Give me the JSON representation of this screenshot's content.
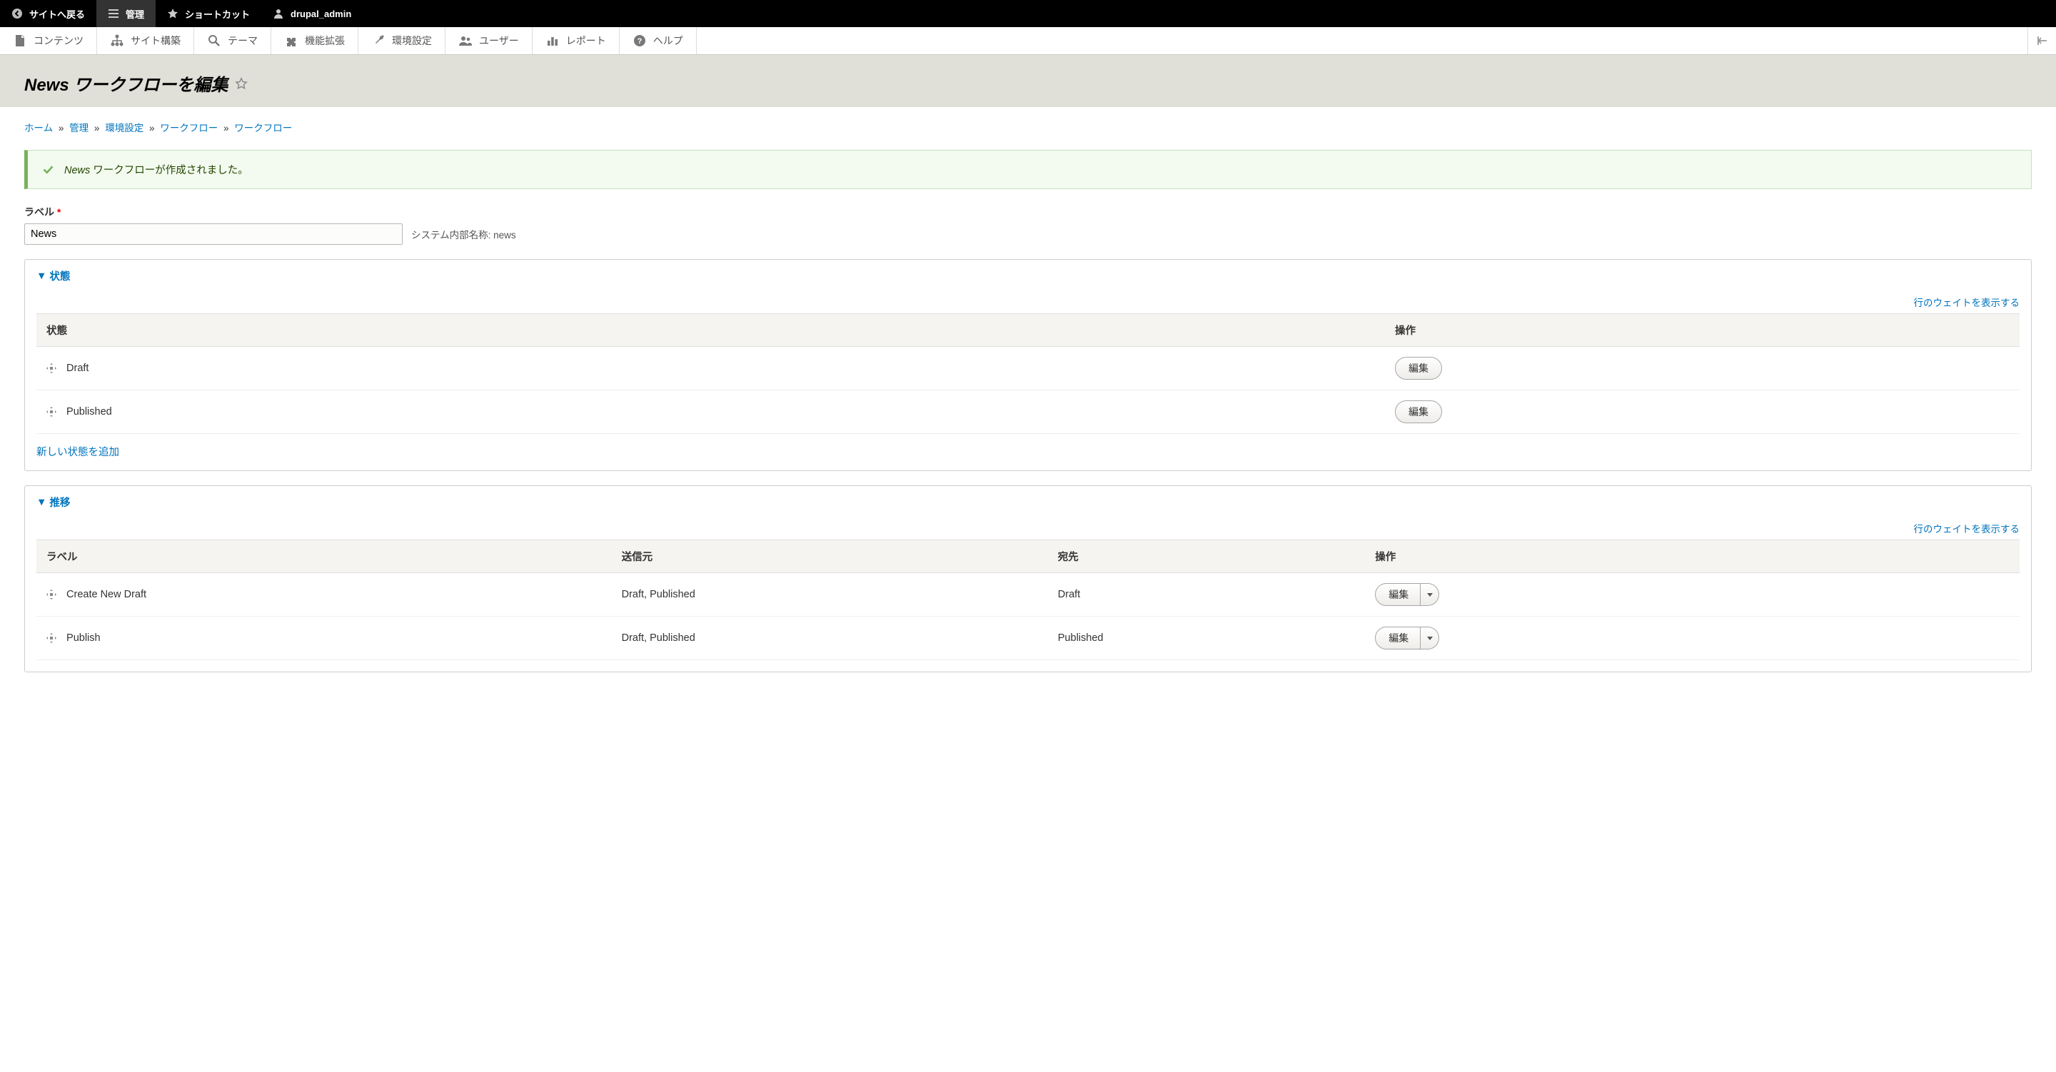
{
  "toolbar_black": {
    "back": "サイトへ戻る",
    "manage": "管理",
    "shortcuts": "ショートカット",
    "user": "drupal_admin"
  },
  "toolbar_white": {
    "items": [
      {
        "name": "content",
        "label": "コンテンツ"
      },
      {
        "name": "structure",
        "label": "サイト構築"
      },
      {
        "name": "appearance",
        "label": "テーマ"
      },
      {
        "name": "extend",
        "label": "機能拡張"
      },
      {
        "name": "config",
        "label": "環境設定"
      },
      {
        "name": "people",
        "label": "ユーザー"
      },
      {
        "name": "reports",
        "label": "レポート"
      },
      {
        "name": "help",
        "label": "ヘルプ"
      }
    ]
  },
  "page_title_prefix": "News",
  "page_title_suffix": " ワークフローを編集",
  "breadcrumb": {
    "items": [
      "ホーム",
      "管理",
      "環境設定",
      "ワークフロー",
      "ワークフロー"
    ]
  },
  "status_message": {
    "em": "News",
    "text": " ワークフローが作成されました。"
  },
  "form": {
    "label_label": "ラベル",
    "label_value": "News",
    "machine_name_prefix": "システム内部名称: ",
    "machine_name_value": "news"
  },
  "states_panel": {
    "title": "状態",
    "show_weights": "行のウェイトを表示する",
    "headers": {
      "state": "状態",
      "ops": "操作"
    },
    "rows": [
      {
        "label": "Draft",
        "op": "編集"
      },
      {
        "label": "Published",
        "op": "編集"
      }
    ],
    "add_link": "新しい状態を追加"
  },
  "transitions_panel": {
    "title": "推移",
    "show_weights": "行のウェイトを表示する",
    "headers": {
      "label": "ラベル",
      "from": "送信元",
      "to": "宛先",
      "ops": "操作"
    },
    "rows": [
      {
        "label": "Create New Draft",
        "from": "Draft, Published",
        "to": "Draft",
        "op": "編集"
      },
      {
        "label": "Publish",
        "from": "Draft, Published",
        "to": "Published",
        "op": "編集"
      }
    ]
  }
}
